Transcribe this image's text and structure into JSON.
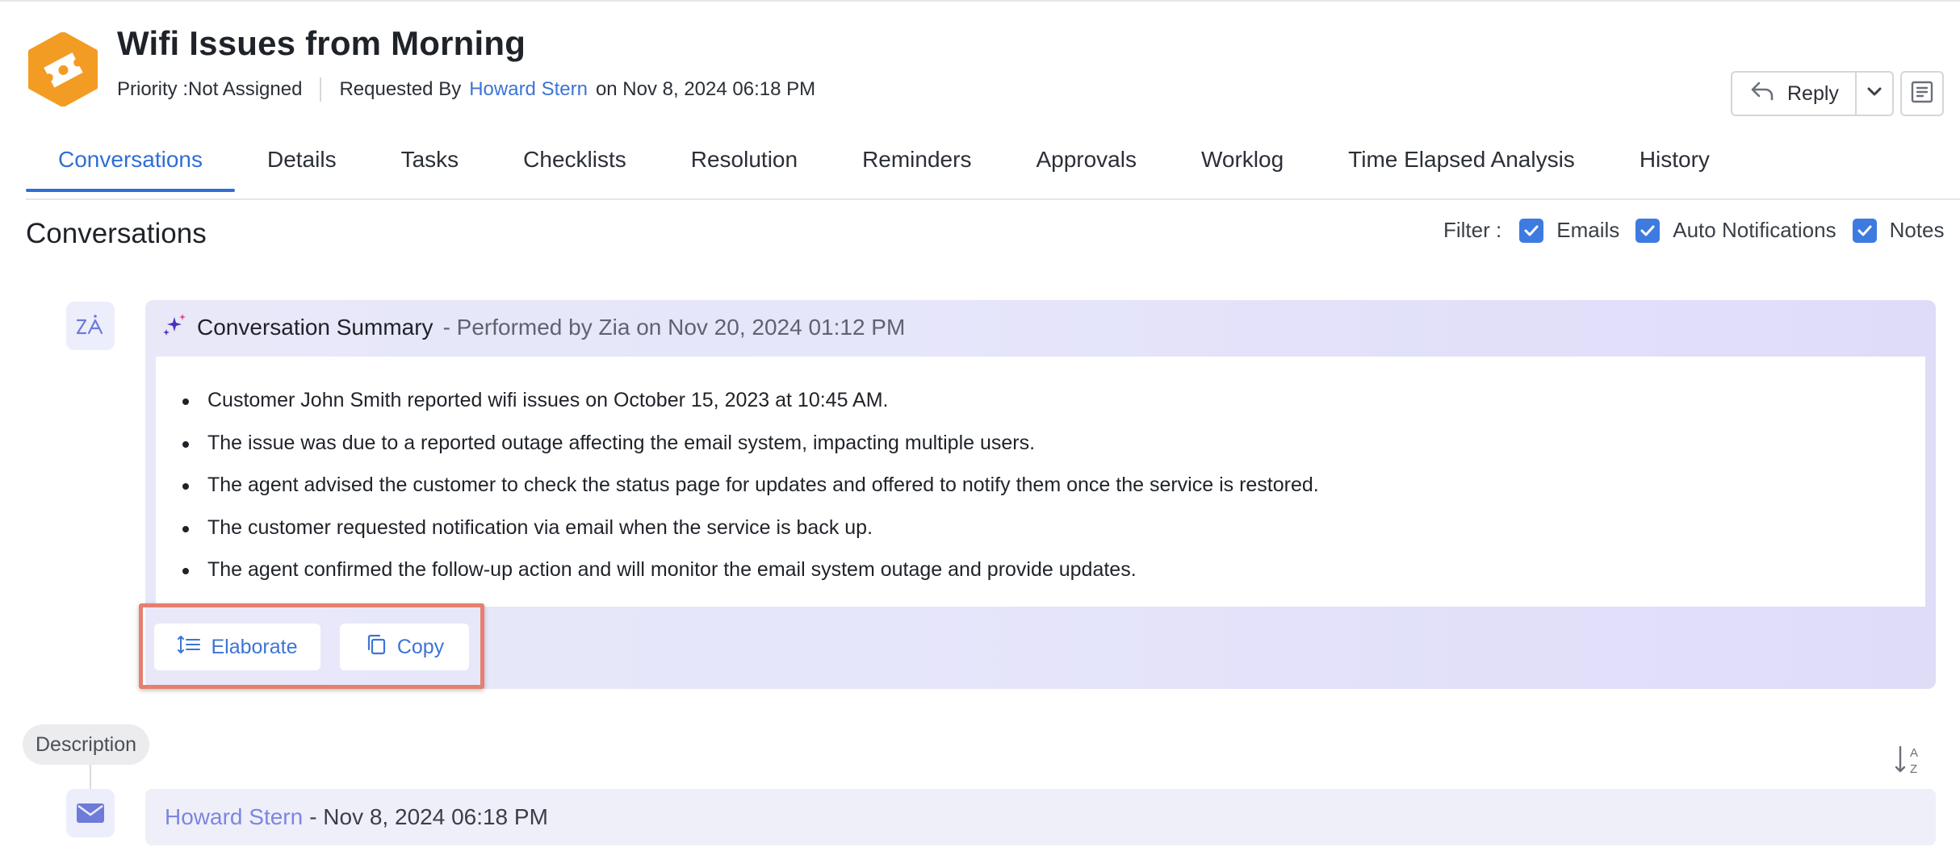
{
  "ticket": {
    "title": "Wifi Issues from Morning",
    "priority": "Priority :Not Assigned",
    "requested_by_label": "Requested By",
    "requester": "Howard Stern",
    "requested_on": "on Nov 8, 2024 06:18 PM"
  },
  "toolbar": {
    "reply_label": "Reply"
  },
  "tabs": [
    {
      "label": "Conversations",
      "active": true
    },
    {
      "label": "Details"
    },
    {
      "label": "Tasks"
    },
    {
      "label": "Checklists"
    },
    {
      "label": "Resolution"
    },
    {
      "label": "Reminders"
    },
    {
      "label": "Approvals"
    },
    {
      "label": "Worklog"
    },
    {
      "label": "Time Elapsed Analysis"
    },
    {
      "label": "History"
    }
  ],
  "section_title": "Conversations",
  "filter": {
    "label": "Filter :",
    "options": [
      {
        "label": "Emails",
        "checked": true
      },
      {
        "label": "Auto Notifications",
        "checked": true
      },
      {
        "label": "Notes",
        "checked": true
      }
    ]
  },
  "summary": {
    "title": "Conversation Summary",
    "performed": "- Performed by Zia on Nov 20, 2024 01:12 PM",
    "points": [
      "Customer John Smith reported wifi issues on October 15, 2023 at 10:45 AM.",
      "The issue was due to a reported outage affecting the email system, impacting multiple users.",
      "The agent advised the customer to check the status page for updates and offered to notify them once the service is restored.",
      "The customer requested notification via email when the service is back up.",
      "The agent confirmed the follow-up action and will monitor the email system outage and provide updates."
    ],
    "elaborate_label": "Elaborate",
    "copy_label": "Copy"
  },
  "description": {
    "label": "Description",
    "author": "Howard Stern",
    "date": "- Nov 8, 2024 06:18 PM"
  },
  "colors": {
    "accent": "#2f6fd6",
    "link": "#3d74d6",
    "logo": "#f39c23",
    "highlight": "#e57f6f"
  },
  "icons": {
    "logo": "ticket-logo-icon",
    "reply": "reply-arrow-icon",
    "dropdown": "chevron-down-icon",
    "notes": "notes-icon",
    "zia": "zia-icon",
    "sparkle": "sparkle-icon",
    "elaborate": "elaborate-icon",
    "copy": "copy-icon",
    "sort": "sort-az-icon",
    "mail": "mail-icon"
  }
}
